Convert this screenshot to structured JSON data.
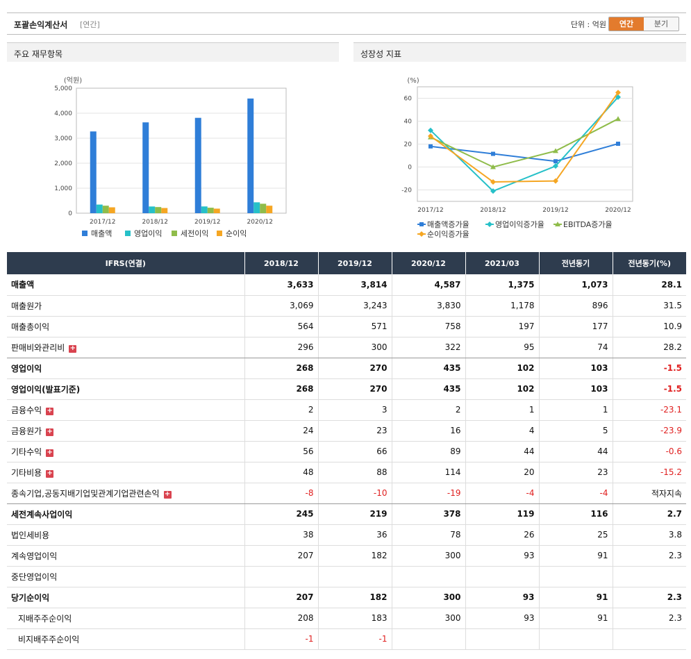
{
  "header": {
    "title": "포괄손익계산서",
    "subtitle": "[연간]",
    "unit": "단위 : 억원",
    "toggle_annual": "연간",
    "toggle_quarter": "분기"
  },
  "left_panel_title": "주요 재무항목",
  "right_panel_title": "성장성 지표",
  "colors": {
    "s1": "#2f7ed8",
    "s2": "#26c0c8",
    "s3": "#8fbc4a",
    "s4": "#f5a623",
    "header_bg": "#2e3c4e",
    "accent": "#e37b2d"
  },
  "chart_data": [
    {
      "type": "bar",
      "unit_label": "(억원)",
      "categories": [
        "2017/12",
        "2018/12",
        "2019/12",
        "2020/12"
      ],
      "ylim": [
        0,
        5000
      ],
      "yticks": [
        "0",
        "1,000",
        "2,000",
        "3,000",
        "4,000",
        "5,000"
      ],
      "series": [
        {
          "name": "매출액",
          "values": [
            3270,
            3633,
            3814,
            4587
          ]
        },
        {
          "name": "영업이익",
          "values": [
            345,
            268,
            270,
            435
          ]
        },
        {
          "name": "세전이익",
          "values": [
            300,
            245,
            219,
            378
          ]
        },
        {
          "name": "순이익",
          "values": [
            235,
            207,
            182,
            300
          ]
        }
      ],
      "grid": true,
      "legend": "bottom"
    },
    {
      "type": "line",
      "unit_label": "(%)",
      "categories": [
        "2017/12",
        "2018/12",
        "2019/12",
        "2020/12"
      ],
      "ylim": [
        -30,
        70
      ],
      "yticks": [
        "-20",
        "0",
        "20",
        "40",
        "60"
      ],
      "series": [
        {
          "name": "매출액증가율",
          "values": [
            18,
            11.5,
            5,
            20.3
          ]
        },
        {
          "name": "영업이익증가율",
          "values": [
            32,
            -21,
            0.8,
            61
          ]
        },
        {
          "name": "EBITDA증가율",
          "values": [
            26,
            0,
            14,
            42
          ]
        },
        {
          "name": "순이익증가율",
          "values": [
            27,
            -13,
            -12.2,
            65
          ]
        }
      ],
      "grid": true,
      "legend": "bottom"
    }
  ],
  "table": {
    "columns": [
      "IFRS(연결)",
      "2018/12",
      "2019/12",
      "2020/12",
      "2021/03",
      "전년동기",
      "전년동기(%)"
    ],
    "rows": [
      {
        "label": "매출액",
        "values": [
          "3,633",
          "3,814",
          "4,587",
          "1,375",
          "1,073",
          "28.1"
        ],
        "bold": true
      },
      {
        "label": "매출원가",
        "values": [
          "3,069",
          "3,243",
          "3,830",
          "1,178",
          "896",
          "31.5"
        ]
      },
      {
        "label": "매출총이익",
        "values": [
          "564",
          "571",
          "758",
          "197",
          "177",
          "10.9"
        ]
      },
      {
        "label": "판매비와관리비",
        "values": [
          "296",
          "300",
          "322",
          "95",
          "74",
          "28.2"
        ],
        "plus": true,
        "sep": true
      },
      {
        "label": "영업이익",
        "values": [
          "268",
          "270",
          "435",
          "102",
          "103",
          "-1.5"
        ],
        "bold": true
      },
      {
        "label": "영업이익(발표기준)",
        "values": [
          "268",
          "270",
          "435",
          "102",
          "103",
          "-1.5"
        ],
        "bold": true
      },
      {
        "label": "금융수익",
        "values": [
          "2",
          "3",
          "2",
          "1",
          "1",
          "-23.1"
        ],
        "plus": true
      },
      {
        "label": "금융원가",
        "values": [
          "24",
          "23",
          "16",
          "4",
          "5",
          "-23.9"
        ],
        "plus": true
      },
      {
        "label": "기타수익",
        "values": [
          "56",
          "66",
          "89",
          "44",
          "44",
          "-0.6"
        ],
        "plus": true
      },
      {
        "label": "기타비용",
        "values": [
          "48",
          "88",
          "114",
          "20",
          "23",
          "-15.2"
        ],
        "plus": true
      },
      {
        "label": "종속기업,공동지배기업및관계기업관련손익",
        "values": [
          "-8",
          "-10",
          "-19",
          "-4",
          "-4",
          "적자지속"
        ],
        "plus": true,
        "sep": true
      },
      {
        "label": "세전계속사업이익",
        "values": [
          "245",
          "219",
          "378",
          "119",
          "116",
          "2.7"
        ],
        "bold": true
      },
      {
        "label": "법인세비용",
        "values": [
          "38",
          "36",
          "78",
          "26",
          "25",
          "3.8"
        ]
      },
      {
        "label": "계속영업이익",
        "values": [
          "207",
          "182",
          "300",
          "93",
          "91",
          "2.3"
        ]
      },
      {
        "label": "중단영업이익",
        "values": [
          "",
          "",
          "",
          "",
          "",
          ""
        ]
      },
      {
        "label": "당기순이익",
        "values": [
          "207",
          "182",
          "300",
          "93",
          "91",
          "2.3"
        ],
        "bold": true
      },
      {
        "label": "지배주주순이익",
        "values": [
          "208",
          "183",
          "300",
          "93",
          "91",
          "2.3"
        ],
        "indent": true
      },
      {
        "label": "비지배주주순이익",
        "values": [
          "-1",
          "-1",
          "",
          "",
          "",
          ""
        ],
        "indent": true
      }
    ]
  }
}
